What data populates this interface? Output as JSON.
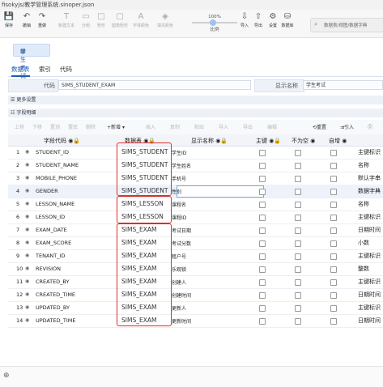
{
  "window": {
    "title": "fisokyjs/教学管理系统.sinoper.json"
  },
  "toolbar": {
    "items": [
      {
        "label": "保存",
        "icon": "save-icon",
        "glyph": "💾",
        "enabled": true
      },
      {
        "label": "撤销",
        "icon": "undo-icon",
        "glyph": "↶",
        "enabled": true
      },
      {
        "label": "重做",
        "icon": "redo-icon",
        "glyph": "↷",
        "enabled": true
      },
      {
        "label": "新建文本",
        "icon": "new-text-icon",
        "glyph": "T",
        "enabled": false
      },
      {
        "label": "分组",
        "icon": "group-icon",
        "glyph": "▭",
        "enabled": false
      },
      {
        "label": "矩形",
        "icon": "rect-icon",
        "glyph": "□",
        "enabled": false
      },
      {
        "label": "圆角矩形",
        "icon": "round-rect-icon",
        "glyph": "▢",
        "enabled": false
      },
      {
        "label": "字体颜色",
        "icon": "font-color-icon",
        "glyph": "A",
        "enabled": false
      },
      {
        "label": "填充颜色",
        "icon": "fill-color-icon",
        "glyph": "◈",
        "enabled": false
      }
    ],
    "zoom": {
      "label": "100%",
      "caption": "比例"
    },
    "right_items": [
      {
        "label": "导入",
        "icon": "import-icon",
        "glyph": "⇩"
      },
      {
        "label": "导出",
        "icon": "export-icon",
        "glyph": "⇧"
      },
      {
        "label": "设置",
        "icon": "settings-icon",
        "glyph": "⚙"
      },
      {
        "label": "数据库",
        "icon": "database-icon",
        "glyph": "⛁"
      }
    ],
    "search_placeholder": "数据表/视图/数据字典"
  },
  "tab": {
    "label": "学生考试"
  },
  "subtabs": [
    "数据表",
    "索引",
    "代码"
  ],
  "form": {
    "code_label": "代码",
    "code_value": "SIMS_STUDENT_EXAM",
    "display_label": "显示名称",
    "display_value": "学生考试"
  },
  "sections": {
    "more": "更多设置",
    "fields": "字段明细"
  },
  "grid_toolbar": {
    "disabled": [
      "上移",
      "下移",
      "置顶",
      "置底",
      "删除"
    ],
    "new_label": "新增",
    "disabled2": [
      "插入",
      "复制",
      "粘贴",
      "导入",
      "导出",
      "编辑"
    ],
    "reset_label": "重置",
    "ref_label": "引入"
  },
  "columns": [
    "字段代码",
    "数据表",
    "显示名称",
    "主键",
    "不为空",
    "自增"
  ],
  "rows": [
    {
      "no": "1",
      "code": "STUDENT_ID",
      "table": "SIMS_STUDENT",
      "name": "学生ID",
      "extra": "主键标识"
    },
    {
      "no": "2",
      "code": "STUDENT_NAME",
      "table": "SIMS_STUDENT",
      "name": "学生姓名",
      "extra": "名称"
    },
    {
      "no": "3",
      "code": "MOBILE_PHONE",
      "table": "SIMS_STUDENT",
      "name": "手机号",
      "extra": "默认字串"
    },
    {
      "no": "4",
      "code": "GENDER",
      "table": "SIMS_STUDENT",
      "name": "性别",
      "extra": "数据字典"
    },
    {
      "no": "5",
      "code": "LESSON_NAME",
      "table": "SIMS_LESSON",
      "name": "课程名",
      "extra": "名称"
    },
    {
      "no": "6",
      "code": "LESSON_ID",
      "table": "SIMS_LESSON",
      "name": "课程ID",
      "extra": "主键标识"
    },
    {
      "no": "7",
      "code": "EXAM_DATE",
      "table": "SIMS_EXAM",
      "name": "考试日期",
      "extra": "日期时间"
    },
    {
      "no": "8",
      "code": "EXAM_SCORE",
      "table": "SIMS_EXAM",
      "name": "考试分数",
      "extra": "小数"
    },
    {
      "no": "9",
      "code": "TENANT_ID",
      "table": "SIMS_EXAM",
      "name": "租户号",
      "extra": "主键标识"
    },
    {
      "no": "10",
      "code": "REVISION",
      "table": "SIMS_EXAM",
      "name": "乐观锁",
      "extra": "整数"
    },
    {
      "no": "11",
      "code": "CREATED_BY",
      "table": "SIMS_EXAM",
      "name": "创建人",
      "extra": "主键标识"
    },
    {
      "no": "12",
      "code": "CREATED_TIME",
      "table": "SIMS_EXAM",
      "name": "创建时间",
      "extra": "日期时间"
    },
    {
      "no": "13",
      "code": "UPDATED_BY",
      "table": "SIMS_EXAM",
      "name": "更新人",
      "extra": "主键标识"
    },
    {
      "no": "14",
      "code": "UPDATED_TIME",
      "table": "SIMS_EXAM",
      "name": "更新时间",
      "extra": "日期时间"
    }
  ],
  "selected_row": 3,
  "colors": {
    "accent": "#1a5bb8",
    "highlight": "#d9302a"
  }
}
